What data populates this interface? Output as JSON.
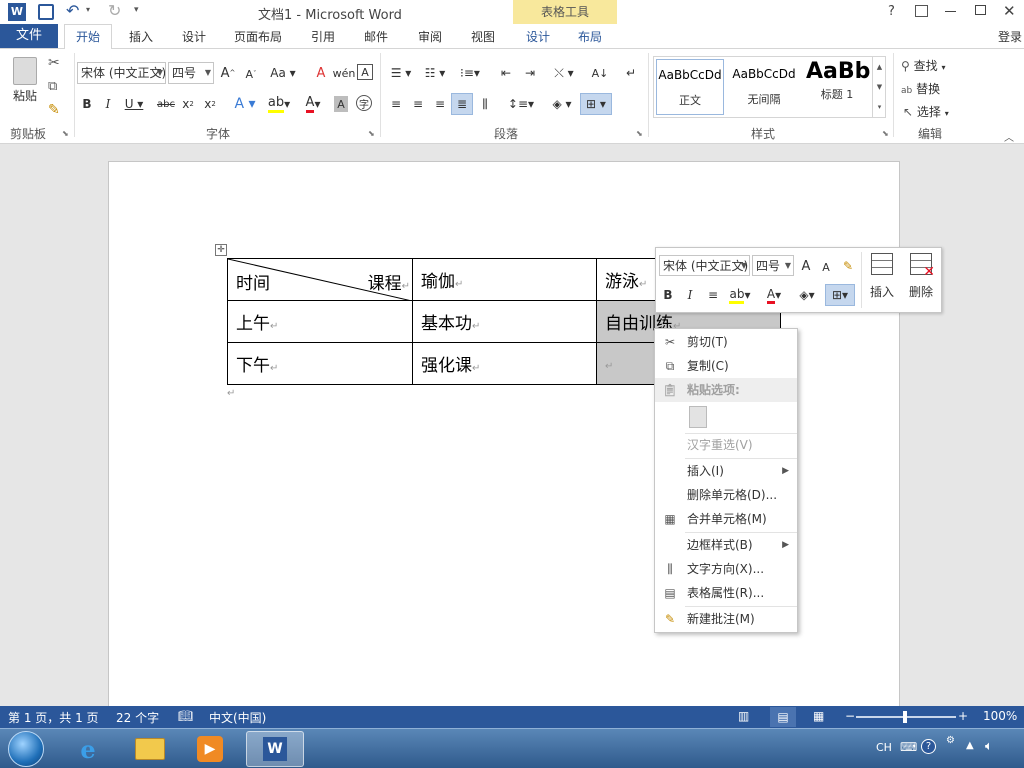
{
  "window": {
    "title": "文档1 - Microsoft Word",
    "context_tab_group": "表格工具",
    "help": "?",
    "login": "登录"
  },
  "tabs": [
    "文件",
    "开始",
    "插入",
    "设计",
    "页面布局",
    "引用",
    "邮件",
    "审阅",
    "视图",
    "设计",
    "布局"
  ],
  "ribbon": {
    "clipboard": {
      "paste": "粘贴",
      "label": "剪贴板"
    },
    "font": {
      "name": "宋体 (中文正文)",
      "size": "四号",
      "label": "字体"
    },
    "paragraph": {
      "label": "段落"
    },
    "styles": {
      "items": [
        {
          "preview": "AaBbCcDd",
          "name": "正文"
        },
        {
          "preview": "AaBbCcDd",
          "name": "无间隔"
        },
        {
          "preview": "AaBb",
          "name": "标题 1"
        }
      ],
      "label": "样式"
    },
    "editing": {
      "find": "查找",
      "replace": "替换",
      "select": "选择",
      "label": "编辑"
    }
  },
  "table": {
    "header": {
      "diag_left": "时间",
      "diag_right": "课程",
      "col2": "瑜伽",
      "col3": "游泳"
    },
    "rows": [
      {
        "c1": "上午",
        "c2": "基本功",
        "c3": "自由训练"
      },
      {
        "c1": "下午",
        "c2": "强化课",
        "c3": ""
      }
    ],
    "para_mark": "↵"
  },
  "mini_toolbar": {
    "font": "宋体 (中文正文)",
    "size": "四号",
    "insert": "插入",
    "delete": "删除"
  },
  "context_menu": {
    "items": [
      {
        "label": "剪切(T)",
        "icon": "scissors-icon",
        "disabled": false
      },
      {
        "label": "复制(C)",
        "icon": "copy-icon",
        "disabled": false
      },
      {
        "label": "粘贴选项:",
        "icon": "paste-icon",
        "disabled": true
      },
      {
        "label": "汉字重选(V)",
        "icon": "",
        "disabled": true
      },
      {
        "label": "插入(I)",
        "icon": "",
        "disabled": false,
        "submenu": true
      },
      {
        "label": "删除单元格(D)...",
        "icon": "",
        "disabled": false
      },
      {
        "label": "合并单元格(M)",
        "icon": "merge-cells-icon",
        "disabled": false
      },
      {
        "label": "边框样式(B)",
        "icon": "",
        "disabled": false,
        "submenu": true
      },
      {
        "label": "文字方向(X)...",
        "icon": "text-direction-icon",
        "disabled": false
      },
      {
        "label": "表格属性(R)...",
        "icon": "table-properties-icon",
        "disabled": false
      },
      {
        "label": "新建批注(M)",
        "icon": "new-comment-icon",
        "disabled": false
      }
    ]
  },
  "status": {
    "page": "第 1 页，共 1 页",
    "words": "22 个字",
    "language": "中文(中国)",
    "zoom": "100%"
  },
  "tray": {
    "lang": "CH"
  },
  "colors": {
    "accent": "#2b579a",
    "context_tab": "#f8e89c",
    "highlight": "#ffff00",
    "font_color": "#e81123"
  }
}
